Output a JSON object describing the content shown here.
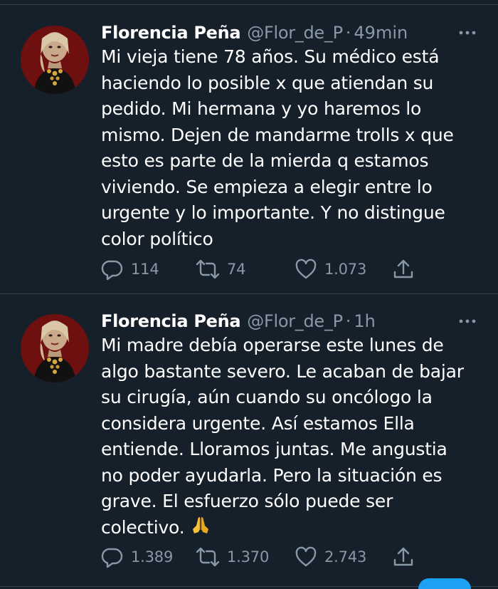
{
  "tweets": [
    {
      "author_name": "Florencia Peña",
      "handle": "@Flor_de_P",
      "separator": "·",
      "time": "49min",
      "text_lines": [
        "Mi vieja tiene 78 años. Su médico está",
        "haciendo lo posible x que atiendan su",
        "pedido. Mi hermana y yo haremos lo",
        "mismo. Dejen de mandarme trolls x que",
        "esto es parte de la mierda q estamos",
        "viviendo. Se empieza a elegir entre lo",
        "urgente y lo importante. Y no distingue",
        "color político"
      ],
      "replies": "114",
      "retweets": "74",
      "likes": "1.073"
    },
    {
      "author_name": "Florencia Peña",
      "handle": "@Flor_de_P",
      "separator": "·",
      "time": "1h",
      "text_lines": [
        "Mi madre debía operarse este lunes de",
        "algo bastante severo. Le acaban de bajar",
        "su cirugía, aún cuando su oncólogo la",
        "considera urgente. Así estamos Ella",
        "entiende. Lloramos juntas. Me angustia",
        "no poder ayudarla. Pero la situación es",
        "grave. El esfuerzo sólo puede ser",
        "colectivo."
      ],
      "emoji": "folded-hands-emoji",
      "replies": "1.389",
      "retweets": "1.370",
      "likes": "2.743"
    }
  ],
  "colors": {
    "background": "#15202b",
    "divider": "#38444d",
    "primary_text": "#ffffff",
    "secondary_text": "#8899a6",
    "accent": "#1da1f2"
  },
  "icons": {
    "reply": "reply-icon",
    "retweet": "retweet-icon",
    "like": "like-icon",
    "share": "share-icon",
    "more": "more-icon"
  }
}
